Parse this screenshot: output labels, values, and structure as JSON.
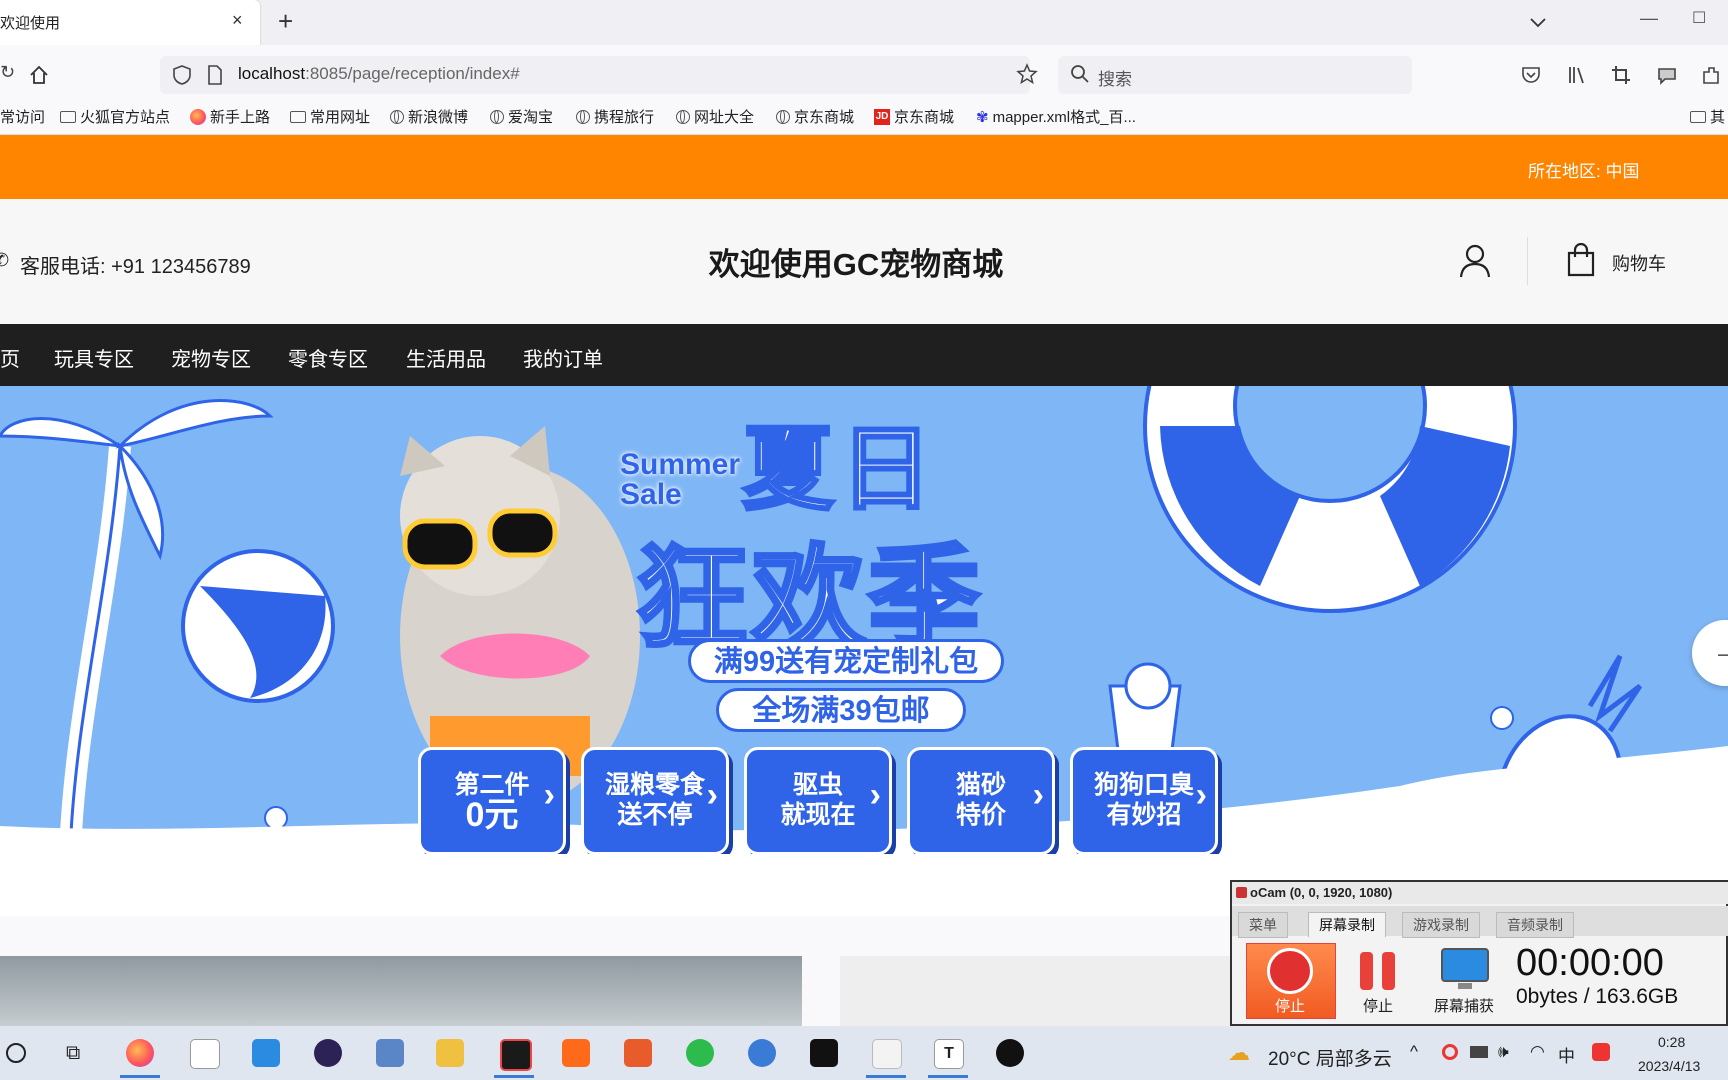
{
  "browser": {
    "tab_title": "欢迎使用",
    "tab_close": "×",
    "new_tab": "+",
    "url_host": "localhost",
    "url_path": ":8085/page/reception/index#",
    "search_placeholder": "搜索",
    "bookmarks": [
      {
        "label": "常访问",
        "icon": "none"
      },
      {
        "label": "火狐官方站点",
        "icon": "folder-icon"
      },
      {
        "label": "新手上路",
        "icon": "firefox-icon"
      },
      {
        "label": "常用网址",
        "icon": "folder-icon"
      },
      {
        "label": "新浪微博",
        "icon": "globe-icon"
      },
      {
        "label": "爱淘宝",
        "icon": "globe-icon"
      },
      {
        "label": "携程旅行",
        "icon": "globe-icon"
      },
      {
        "label": "网址大全",
        "icon": "globe-icon"
      },
      {
        "label": "京东商城",
        "icon": "globe-icon"
      },
      {
        "label": "京东商城",
        "icon": "jd-icon"
      },
      {
        "label": "mapper.xml格式_百...",
        "icon": "baidu-icon"
      },
      {
        "label": "其",
        "icon": "folder-icon"
      }
    ]
  },
  "site": {
    "region": "所在地区: 中国",
    "phone": "客服电话: +91 123456789",
    "title": "欢迎使用GC宠物商城",
    "cart_label": "购物车",
    "nav": [
      "页",
      "玩具专区",
      "宠物专区",
      "零食专区",
      "生活用品",
      "我的订单"
    ],
    "accent_color": "#ff8400",
    "nav_bg": "#1f1f1f"
  },
  "banner": {
    "summer_sale": "Summer Sale",
    "headline_1": "夏日",
    "headline_2": "狂欢季",
    "sub_1": "满99送有宠定制礼包",
    "sub_2": "全场满39包邮",
    "promos": [
      {
        "line1": "第二件",
        "line2": "0元"
      },
      {
        "line1": "湿粮零食",
        "line2": "送不停"
      },
      {
        "line1": "驱虫",
        "line2": "就现在"
      },
      {
        "line1": "猫砂",
        "line2": "特价"
      },
      {
        "line1": "狗狗口臭",
        "line2": "有妙招"
      }
    ],
    "arrow": "›",
    "next": "→"
  },
  "ocam": {
    "title": "oCam (0, 0, 1920, 1080)",
    "tabs": [
      "菜单",
      "屏幕录制",
      "游戏录制",
      "音频录制"
    ],
    "stop_label": "停止",
    "pause_label": "停止",
    "capture_label": "屏幕捕获",
    "time": "00:00:00",
    "size": "0bytes / 163.6GB"
  },
  "taskbar": {
    "weather": "20°C 局部多云",
    "time": "0:28",
    "date": "2023/4/13",
    "ime": "中"
  }
}
